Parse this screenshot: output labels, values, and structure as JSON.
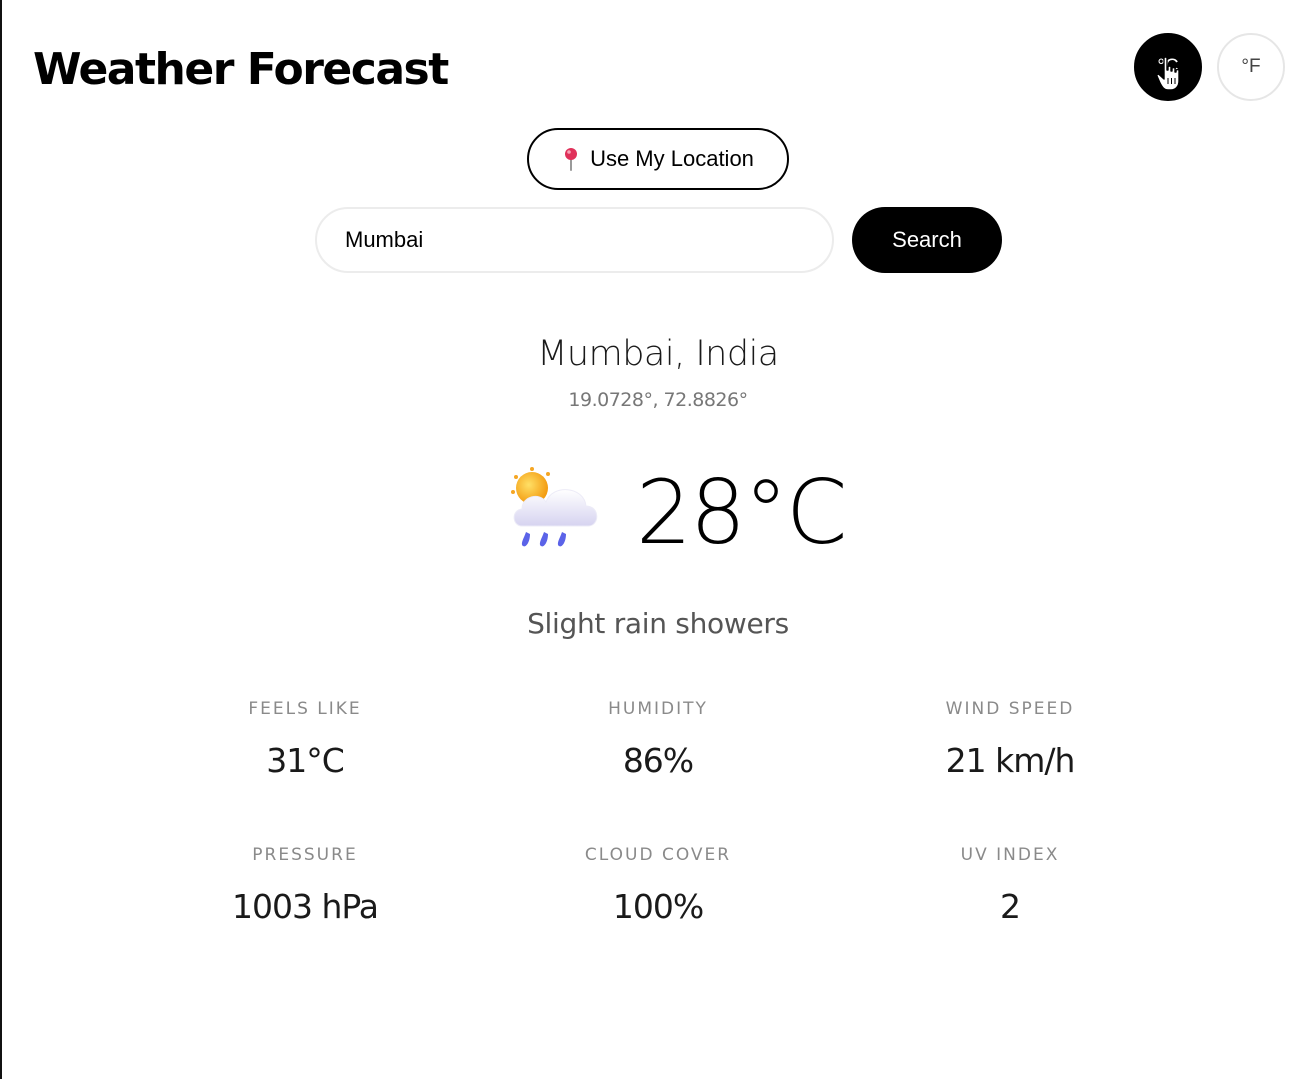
{
  "header": {
    "title": "Weather Forecast"
  },
  "units": {
    "celsius_label": "°C",
    "fahrenheit_label": "°F",
    "selected": "°C"
  },
  "location_button": {
    "label": "Use My Location",
    "icon": "map-pin-icon"
  },
  "search": {
    "value": "Mumbai",
    "button_label": "Search"
  },
  "current": {
    "location": "Mumbai, India",
    "coordinates": "19.0728°, 72.8826°",
    "temperature": "28°C",
    "condition": "Slight rain showers",
    "icon": "sun-behind-rain-cloud-icon"
  },
  "stats": [
    {
      "label": "FEELS LIKE",
      "value": "31°C"
    },
    {
      "label": "HUMIDITY",
      "value": "86%"
    },
    {
      "label": "WIND SPEED",
      "value": "21 km/h"
    },
    {
      "label": "PRESSURE",
      "value": "1003 hPa"
    },
    {
      "label": "CLOUD COVER",
      "value": "100%"
    },
    {
      "label": "UV INDEX",
      "value": "2"
    }
  ],
  "colors": {
    "primary": "#000000",
    "background": "#ffffff",
    "muted_text": "#8a8a8a",
    "rain_drops": "#5b63e8",
    "sun": "#f5a623"
  }
}
